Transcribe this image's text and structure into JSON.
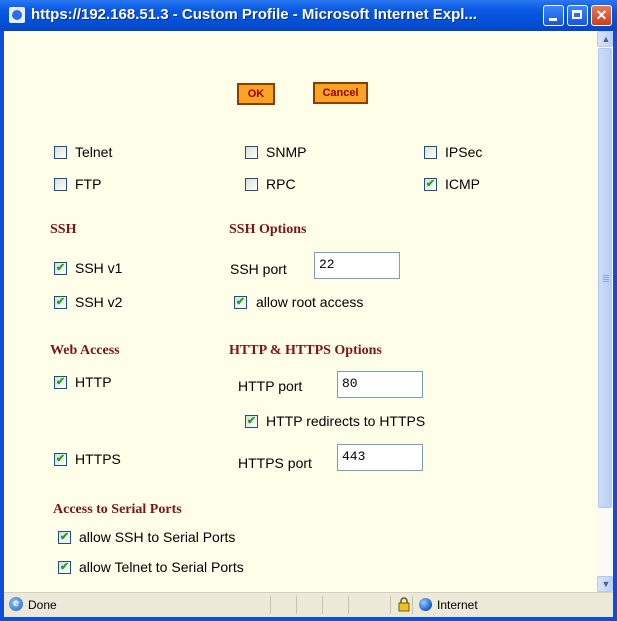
{
  "window": {
    "title": "https://192.168.51.3 - Custom Profile - Microsoft Internet Expl...",
    "icon": "ie-page-icon"
  },
  "buttons": {
    "ok": "OK",
    "cancel": "Cancel"
  },
  "services": {
    "telnet": {
      "label": "Telnet",
      "checked": false
    },
    "snmp": {
      "label": "SNMP",
      "checked": false
    },
    "ipsec": {
      "label": "IPSec",
      "checked": false
    },
    "ftp": {
      "label": "FTP",
      "checked": false
    },
    "rpc": {
      "label": "RPC",
      "checked": false
    },
    "icmp": {
      "label": "ICMP",
      "checked": true
    }
  },
  "ssh": {
    "heading": "SSH",
    "v1": {
      "label": "SSH v1",
      "checked": true
    },
    "v2": {
      "label": "SSH v2",
      "checked": true
    }
  },
  "ssh_options": {
    "heading": "SSH Options",
    "port_label": "SSH port",
    "port_value": "22",
    "root_access": {
      "label": "allow root access",
      "checked": true
    }
  },
  "web_access": {
    "heading": "Web Access",
    "http": {
      "label": "HTTP",
      "checked": true
    },
    "https": {
      "label": "HTTPS",
      "checked": true
    }
  },
  "http_options": {
    "heading": "HTTP & HTTPS Options",
    "http_port_label": "HTTP port",
    "http_port_value": "80",
    "redirect": {
      "label": "HTTP redirects to HTTPS",
      "checked": true
    },
    "https_port_label": "HTTPS port",
    "https_port_value": "443"
  },
  "serial": {
    "heading": "Access to Serial Ports",
    "ssh": {
      "label": "allow SSH to Serial Ports",
      "checked": true
    },
    "telnet": {
      "label": "allow Telnet to Serial Ports",
      "checked": true
    }
  },
  "status": {
    "text": "Done",
    "zone": "Internet"
  },
  "colors": {
    "titlebar": "#0450d8",
    "background": "#ffffe9",
    "heading": "#7c1616",
    "button": "#f8a321",
    "check": "#21a121"
  }
}
